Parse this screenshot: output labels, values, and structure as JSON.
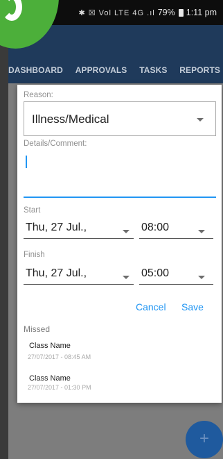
{
  "status_bar": {
    "icons": "✱ ☒ Vol LTE 4G .ıl",
    "battery": "79%",
    "time": "1:11 pm"
  },
  "tabs": [
    {
      "label": "DASHBOARD"
    },
    {
      "label": "APPROVALS"
    },
    {
      "label": "TASKS"
    },
    {
      "label": "REPORTS"
    }
  ],
  "dialog": {
    "reason_label": "Reason:",
    "reason_value": "Illness/Medical",
    "comment_label": "Details/Comment:",
    "comment_value": "",
    "start_label": "Start",
    "start_date": "Thu, 27 Jul.,",
    "start_time": "08:00",
    "finish_label": "Finish",
    "finish_date": "Thu, 27 Jul.,",
    "finish_time": "05:00",
    "cancel_label": "Cancel",
    "save_label": "Save",
    "missed_label": "Missed",
    "missed": [
      {
        "name": "Class Name",
        "time": "27/07/2017 - 08:45 AM"
      },
      {
        "name": "Class Name",
        "time": "27/07/2017 - 01:30 PM"
      }
    ]
  },
  "fab": {
    "icon": "plus-icon",
    "symbol": "+"
  },
  "colors": {
    "appbar": "#1f3a5b",
    "accent": "#2196f3",
    "logo": "#4caf3a",
    "fab": "#1f5a9e"
  }
}
